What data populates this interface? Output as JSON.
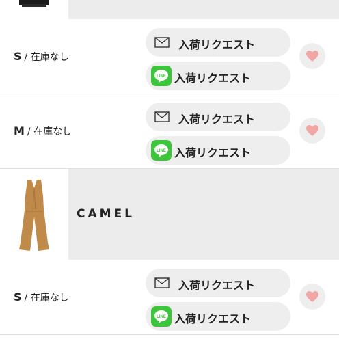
{
  "colors": {
    "accent_line": "#3dc53b",
    "heart": "#f3a6a6",
    "pill_bg": "#eeeeee",
    "header_bg": "#ececec"
  },
  "color_headers": [
    {
      "name": ""
    },
    {
      "name": "CAMEL"
    }
  ],
  "stock_status": "在庫なし",
  "separator": "/",
  "size_rows": [
    {
      "size": "S",
      "mail_request_label": "入荷リクエスト",
      "line_request_label": "入荷リクエスト"
    },
    {
      "size": "M",
      "mail_request_label": "入荷リクエスト",
      "line_request_label": "入荷リクエスト"
    },
    {
      "size": "S",
      "mail_request_label": "入荷リクエスト",
      "line_request_label": "入荷リクエスト"
    }
  ],
  "icons": {
    "mail": "envelope-icon",
    "line": "line-app-icon",
    "favorite": "heart-icon"
  }
}
